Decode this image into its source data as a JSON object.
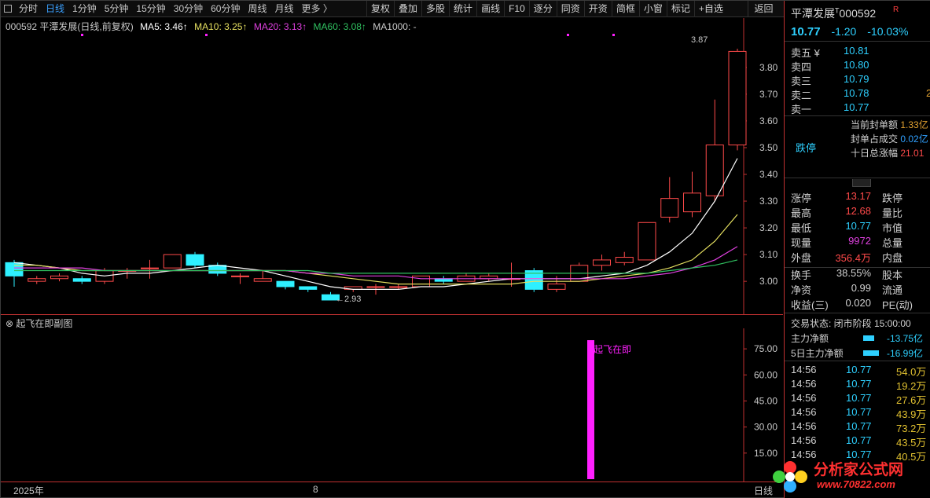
{
  "toolbar": {
    "periods": [
      "分时",
      "日线",
      "1分钟",
      "5分钟",
      "15分钟",
      "30分钟",
      "60分钟",
      "周线",
      "月线",
      "更多 〉"
    ],
    "active_period": "日线",
    "tools": [
      "复权",
      "叠加",
      "多股",
      "统计",
      "画线",
      "F10",
      "逐分",
      "同资",
      "开资",
      "简框",
      "小窗",
      "标记",
      "+自选"
    ],
    "back": "返回"
  },
  "legend": {
    "title": "000592 平潭发展(日线,前复权)",
    "ma5": "MA5: 3.46↑",
    "ma10": "MA10: 3.25↑",
    "ma20": "MA20: 3.13↑",
    "ma60": "MA60: 3.08↑",
    "ma1000": "MA1000: -"
  },
  "colors": {
    "up": "#ff4a4a",
    "down": "#2ef0ff",
    "ma5": "#ffffff",
    "ma10": "#e6e060",
    "ma20": "#e040e0",
    "ma60": "#30c060",
    "signal": "#ff20ff",
    "accent": "#2ed0ff"
  },
  "chart_data": [
    {
      "type": "candlestick",
      "title": "000592 平潭发展(日线,前复权)",
      "ylim": [
        2.88,
        3.92
      ],
      "yticks": [
        "3.80",
        "3.70",
        "3.60",
        "3.50",
        "3.40",
        "3.30",
        "3.20",
        "3.10",
        "3.00"
      ],
      "candles": [
        {
          "o": 3.07,
          "c": 3.02,
          "h": 3.08,
          "l": 2.98
        },
        {
          "o": 3.0,
          "c": 3.01,
          "h": 3.02,
          "l": 2.99
        },
        {
          "o": 3.01,
          "c": 3.02,
          "h": 3.03,
          "l": 3.0
        },
        {
          "o": 3.01,
          "c": 3.0,
          "h": 3.02,
          "l": 2.99
        },
        {
          "o": 3.0,
          "c": 3.04,
          "h": 3.05,
          "l": 2.99
        },
        {
          "o": 3.04,
          "c": 3.04,
          "h": 3.05,
          "l": 3.01
        },
        {
          "o": 3.05,
          "c": 3.05,
          "h": 3.08,
          "l": 3.01
        },
        {
          "o": 3.05,
          "c": 3.1,
          "h": 3.1,
          "l": 3.05
        },
        {
          "o": 3.1,
          "c": 3.06,
          "h": 3.11,
          "l": 3.05
        },
        {
          "o": 3.06,
          "c": 3.03,
          "h": 3.07,
          "l": 3.02
        },
        {
          "o": 3.02,
          "c": 3.02,
          "h": 3.03,
          "l": 2.99
        },
        {
          "o": 3.0,
          "c": 3.01,
          "h": 3.04,
          "l": 3.0
        },
        {
          "o": 3.0,
          "c": 2.98,
          "h": 3.0,
          "l": 2.97
        },
        {
          "o": 2.98,
          "c": 2.97,
          "h": 2.98,
          "l": 2.96
        },
        {
          "o": 2.95,
          "c": 2.93,
          "h": 2.96,
          "l": 2.93
        },
        {
          "o": 2.97,
          "c": 2.98,
          "h": 2.98,
          "l": 2.96
        },
        {
          "o": 2.98,
          "c": 2.98,
          "h": 2.99,
          "l": 2.95
        },
        {
          "o": 2.98,
          "c": 2.98,
          "h": 2.99,
          "l": 2.97
        },
        {
          "o": 2.98,
          "c": 3.02,
          "h": 3.02,
          "l": 2.98
        },
        {
          "o": 3.01,
          "c": 3.0,
          "h": 3.02,
          "l": 2.99
        },
        {
          "o": 3.0,
          "c": 3.02,
          "h": 3.03,
          "l": 3.0
        },
        {
          "o": 3.01,
          "c": 3.02,
          "h": 3.03,
          "l": 3.0
        },
        {
          "o": 3.01,
          "c": 3.01,
          "h": 3.07,
          "l": 2.98
        },
        {
          "o": 3.04,
          "c": 2.97,
          "h": 3.05,
          "l": 2.96
        },
        {
          "o": 2.97,
          "c": 2.99,
          "h": 3.02,
          "l": 2.96
        },
        {
          "o": 3.0,
          "c": 3.06,
          "h": 3.07,
          "l": 3.0
        },
        {
          "o": 3.06,
          "c": 3.08,
          "h": 3.1,
          "l": 3.04
        },
        {
          "o": 3.07,
          "c": 3.09,
          "h": 3.11,
          "l": 3.06
        },
        {
          "o": 3.08,
          "c": 3.22,
          "h": 3.22,
          "l": 3.08
        },
        {
          "o": 3.24,
          "c": 3.31,
          "h": 3.39,
          "l": 3.22
        },
        {
          "o": 3.26,
          "c": 3.33,
          "h": 3.41,
          "l": 3.24
        },
        {
          "o": 3.32,
          "c": 3.51,
          "h": 3.68,
          "l": 3.3
        },
        {
          "o": 3.51,
          "c": 3.86,
          "h": 3.87,
          "l": 3.49
        }
      ],
      "series": [
        {
          "name": "MA5",
          "values": [
            3.07,
            3.06,
            3.05,
            3.03,
            3.02,
            3.03,
            3.03,
            3.04,
            3.05,
            3.06,
            3.05,
            3.04,
            3.02,
            3.0,
            2.98,
            2.97,
            2.97,
            2.97,
            2.98,
            2.98,
            2.99,
            3.0,
            3.01,
            3.01,
            3.01,
            3.01,
            3.02,
            3.03,
            3.06,
            3.11,
            3.18,
            3.3,
            3.46
          ]
        },
        {
          "name": "MA10",
          "values": [
            3.06,
            3.06,
            3.05,
            3.04,
            3.04,
            3.04,
            3.04,
            3.04,
            3.04,
            3.04,
            3.04,
            3.04,
            3.04,
            3.03,
            3.02,
            3.01,
            3.0,
            2.99,
            2.99,
            2.99,
            2.99,
            2.99,
            2.99,
            3.0,
            3.0,
            3.0,
            3.01,
            3.02,
            3.03,
            3.05,
            3.08,
            3.15,
            3.25
          ]
        },
        {
          "name": "MA20",
          "values": [
            3.05,
            3.05,
            3.05,
            3.05,
            3.04,
            3.04,
            3.04,
            3.04,
            3.04,
            3.04,
            3.04,
            3.04,
            3.04,
            3.03,
            3.03,
            3.02,
            3.02,
            3.02,
            3.01,
            3.01,
            3.01,
            3.01,
            3.01,
            3.01,
            3.01,
            3.01,
            3.01,
            3.01,
            3.02,
            3.03,
            3.05,
            3.08,
            3.13
          ]
        },
        {
          "name": "MA60",
          "values": [
            3.04,
            3.04,
            3.04,
            3.04,
            3.04,
            3.04,
            3.04,
            3.04,
            3.04,
            3.04,
            3.04,
            3.04,
            3.04,
            3.04,
            3.03,
            3.03,
            3.03,
            3.03,
            3.03,
            3.03,
            3.03,
            3.03,
            3.03,
            3.03,
            3.03,
            3.03,
            3.03,
            3.03,
            3.03,
            3.04,
            3.05,
            3.06,
            3.08
          ]
        }
      ],
      "annotations": {
        "high_label": "3.87",
        "low_label": "←2.93"
      }
    },
    {
      "type": "bar",
      "title": "起飞在即副图",
      "ylim": [
        0,
        85
      ],
      "yticks": [
        "75.00",
        "60.00",
        "45.00",
        "30.00",
        "15.00"
      ],
      "values": [
        0,
        0,
        0,
        0,
        0,
        0,
        0,
        0,
        0,
        0,
        0,
        0,
        0,
        0,
        0,
        0,
        0,
        0,
        0,
        0,
        0,
        0,
        0,
        0,
        0,
        0,
        0,
        0,
        0,
        0,
        0,
        0,
        80
      ],
      "signal_label": "起飞在即"
    }
  ],
  "date_axis": {
    "start": "2025年",
    "mid": "8",
    "end": "日线"
  },
  "side": {
    "name": "平潭发展",
    "superscript": "T",
    "code": "000592",
    "badge": "R",
    "price": "10.77",
    "change": "-1.20",
    "pct": "-10.03%",
    "asks": [
      {
        "label": "卖五 ¥",
        "price": "10.81",
        "vol": ""
      },
      {
        "label": "卖四",
        "price": "10.80",
        "vol": ""
      },
      {
        "label": "卖三",
        "price": "10.79",
        "vol": ""
      },
      {
        "label": "卖二",
        "price": "10.78",
        "vol": "2"
      },
      {
        "label": "卖一",
        "price": "10.77",
        "vol": ""
      }
    ],
    "limit_tag": "跌停",
    "limit_lines": [
      {
        "k": "当前封单额",
        "v": "1.33亿"
      },
      {
        "k": "封单占成交",
        "v": "0.02亿"
      },
      {
        "k": "十日总涨幅",
        "v": "21.01"
      }
    ],
    "stats": [
      {
        "a": "涨停",
        "b": "13.17",
        "c": "跌停",
        "color": "#ff4a4a"
      },
      {
        "a": "最高",
        "b": "12.68",
        "c": "量比",
        "color": "#ff4a4a"
      },
      {
        "a": "最低",
        "b": "10.77",
        "c": "市值",
        "color": "#2ed0ff"
      },
      {
        "a": "现量",
        "b": "9972",
        "c": "总量",
        "color": "#e040e0"
      },
      {
        "a": "外盘",
        "b": "356.4万",
        "c": "内盘",
        "color": "#ff4a4a"
      }
    ],
    "stats2": [
      {
        "a": "换手",
        "b": "38.55%",
        "c": "股本",
        "color": "#d0d0d0"
      },
      {
        "a": "净资",
        "b": "0.99",
        "c": "流通",
        "color": "#d0d0d0"
      },
      {
        "a": "收益(三)",
        "b": "0.020",
        "c": "PE(动)",
        "color": "#d0d0d0"
      }
    ],
    "trade_status": "交易状态: 闭市阶段 15:00:00",
    "flows": [
      {
        "k": "主力净额",
        "v": "-13.75亿"
      },
      {
        "k": "5日主力净额",
        "v": "-16.99亿"
      }
    ],
    "ticks": [
      {
        "t": "14:56",
        "p": "10.77",
        "v": "54.0万"
      },
      {
        "t": "14:56",
        "p": "10.77",
        "v": "19.2万"
      },
      {
        "t": "14:56",
        "p": "10.77",
        "v": "27.6万"
      },
      {
        "t": "14:56",
        "p": "10.77",
        "v": "43.9万"
      },
      {
        "t": "14:56",
        "p": "10.77",
        "v": "73.2万"
      },
      {
        "t": "14:56",
        "p": "10.77",
        "v": "43.5万"
      },
      {
        "t": "14:56",
        "p": "10.77",
        "v": "40.5万"
      }
    ]
  },
  "watermark": {
    "text": "分析家公式网",
    "url": "www.70822.com"
  }
}
